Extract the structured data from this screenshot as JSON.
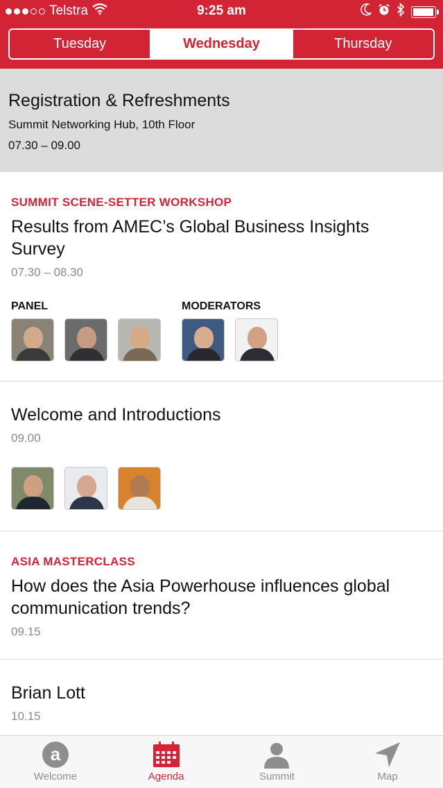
{
  "status_bar": {
    "carrier": "Telstra",
    "time": "9:25 am",
    "icons": [
      "signal-dots-icon",
      "wifi-icon",
      "moon-icon",
      "alarm-icon",
      "bluetooth-icon",
      "battery-icon"
    ],
    "battery_level": 0.95
  },
  "day_tabs": [
    {
      "label": "Tuesday",
      "active": false
    },
    {
      "label": "Wednesday",
      "active": true
    },
    {
      "label": "Thursday",
      "active": false
    }
  ],
  "banner": {
    "title": "Registration & Refreshments",
    "location": "Summit Networking Hub, 10th Floor",
    "time": "07.30 – 09.00"
  },
  "sessions": [
    {
      "category": "SUMMIT SCENE-SETTER WORKSHOP",
      "title": "Results from AMEC’s Global Business Insights Survey",
      "time": "07.30 – 08.30",
      "panel_label": "PANEL",
      "moderators_label": "MODERATORS"
    },
    {
      "title": "Welcome and Introductions",
      "time": "09.00"
    },
    {
      "category": "ASIA MASTERCLASS",
      "title": "How does the Asia Powerhouse influences global communication trends?",
      "time": "09.15"
    },
    {
      "title": "Brian Lott",
      "time": "10.15"
    }
  ],
  "tabbar": [
    {
      "label": "Welcome",
      "icon": "welcome-a-icon",
      "active": false
    },
    {
      "label": "Agenda",
      "icon": "calendar-icon",
      "active": true
    },
    {
      "label": "Summit",
      "icon": "person-icon",
      "active": false
    },
    {
      "label": "Map",
      "icon": "location-arrow-icon",
      "active": false
    }
  ],
  "colors": {
    "brand_red": "#d22434",
    "banner_gray": "#dcdcdc",
    "muted_text": "#8a8a8a"
  }
}
